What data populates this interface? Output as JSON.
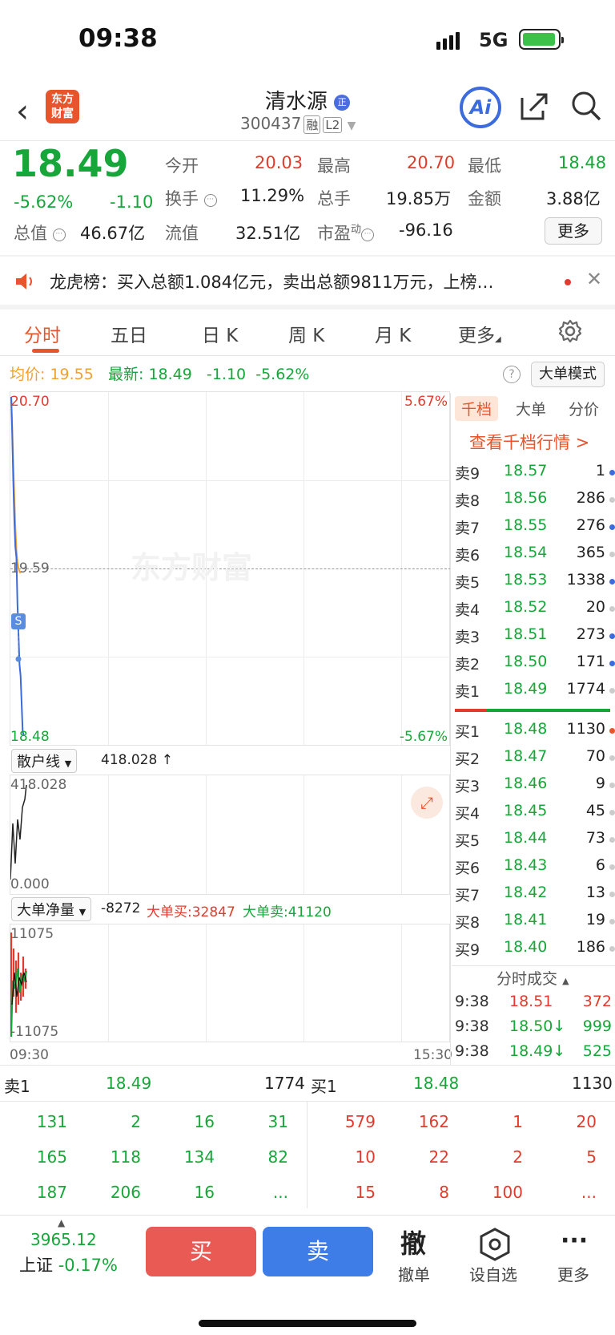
{
  "status": {
    "time": "09:38",
    "network": "5G"
  },
  "header": {
    "stock_name": "清水源",
    "badge": "正",
    "code": "300437",
    "tag_margin": "融",
    "tag_level": "L2",
    "logo_line1": "东方",
    "logo_line2": "财富",
    "ai_label": "Ai"
  },
  "quote": {
    "price": "18.49",
    "change_pct": "-5.62%",
    "change": "-1.10",
    "open_label": "今开",
    "open": "20.03",
    "high_label": "最高",
    "high": "20.70",
    "low_label": "最低",
    "low": "18.48",
    "turnover_label": "换手",
    "turnover": "11.29%",
    "volume_label": "总手",
    "volume": "19.85万",
    "amount_label": "金额",
    "amount": "3.88亿",
    "mktcap_label": "总值",
    "mktcap": "46.67亿",
    "float_label": "流值",
    "float": "32.51亿",
    "pe_label": "市盈",
    "pe_sup": "动",
    "pe": "-96.16",
    "more": "更多"
  },
  "notice": {
    "text": "龙虎榜：买入总额1.084亿元，卖出总额9811万元，上榜…"
  },
  "tabs": [
    "分时",
    "五日",
    "日 K",
    "周 K",
    "月 K",
    "更多"
  ],
  "avg": {
    "avg_label": "均价:",
    "avg": "19.55",
    "latest_label": "最新:",
    "latest": "18.49",
    "chg": "-1.10",
    "pct": "-5.62%",
    "bigmode": "大单模式",
    "help": "?"
  },
  "chart": {
    "y_high": "20.70",
    "y_mid": "19.59",
    "y_low": "18.48",
    "pct_high": "5.67%",
    "pct_low": "-5.67%",
    "s_marker": "S",
    "watermark": "东方财富",
    "sub1_select": "散户线",
    "sub1_value": "418.028 ↑",
    "sub1_top": "418.028",
    "sub1_bottom": "0.000",
    "sub2_select": "大单净量",
    "sub2_value": "-8272",
    "sub2_buy": "大单买:32847",
    "sub2_sell": "大单卖:41120",
    "sub2_top": "11075",
    "sub2_bottom": "-11075",
    "t_start": "09:30",
    "t_end": "15:30",
    "price_points": [
      20.7,
      20.45,
      20.15,
      19.9,
      19.72,
      19.65,
      19.35,
      19.15,
      18.95,
      18.88,
      18.7,
      18.52,
      18.49
    ],
    "avg_points": [
      20.7,
      20.5,
      20.25,
      20.05,
      19.85,
      19.7,
      19.62,
      19.58,
      19.56,
      19.55
    ]
  },
  "orderbook": {
    "tabs": [
      "千档",
      "大单",
      "分价"
    ],
    "link": "查看千档行情 >",
    "asks": [
      {
        "l": "卖9",
        "p": "18.57",
        "v": "1",
        "c": "#3b6bdc"
      },
      {
        "l": "卖8",
        "p": "18.56",
        "v": "286",
        "c": "#ccc"
      },
      {
        "l": "卖7",
        "p": "18.55",
        "v": "276",
        "c": "#3b6bdc"
      },
      {
        "l": "卖6",
        "p": "18.54",
        "v": "365",
        "c": "#ccc"
      },
      {
        "l": "卖5",
        "p": "18.53",
        "v": "1338",
        "c": "#3b6bdc"
      },
      {
        "l": "卖4",
        "p": "18.52",
        "v": "20",
        "c": "#ccc"
      },
      {
        "l": "卖3",
        "p": "18.51",
        "v": "273",
        "c": "#3b6bdc"
      },
      {
        "l": "卖2",
        "p": "18.50",
        "v": "171",
        "c": "#3b6bdc"
      },
      {
        "l": "卖1",
        "p": "18.49",
        "v": "1774",
        "c": "#ccc"
      }
    ],
    "bids": [
      {
        "l": "买1",
        "p": "18.48",
        "v": "1130",
        "c": "#e8542b"
      },
      {
        "l": "买2",
        "p": "18.47",
        "v": "70",
        "c": "#ccc"
      },
      {
        "l": "买3",
        "p": "18.46",
        "v": "9",
        "c": "#ccc"
      },
      {
        "l": "买4",
        "p": "18.45",
        "v": "45",
        "c": "#ccc"
      },
      {
        "l": "买5",
        "p": "18.44",
        "v": "73",
        "c": "#ccc"
      },
      {
        "l": "买6",
        "p": "18.43",
        "v": "6",
        "c": "#ccc"
      },
      {
        "l": "买7",
        "p": "18.42",
        "v": "13",
        "c": "#ccc"
      },
      {
        "l": "买8",
        "p": "18.41",
        "v": "19",
        "c": "#ccc"
      },
      {
        "l": "买9",
        "p": "18.40",
        "v": "186",
        "c": "#ccc"
      }
    ],
    "trades_title": "分时成交",
    "trades": [
      {
        "t": "9:38",
        "p": "18.51",
        "v": "372",
        "c": "red"
      },
      {
        "t": "9:38",
        "p": "18.50↓",
        "v": "999",
        "c": "green"
      },
      {
        "t": "9:38",
        "p": "18.49↓",
        "v": "525",
        "c": "green"
      }
    ]
  },
  "level1": {
    "sell_label": "卖1",
    "sell_price": "18.49",
    "sell_vol": "1774",
    "buy_label": "买1",
    "buy_price": "18.48",
    "buy_vol": "1130",
    "sell_queue": [
      [
        "131",
        "2",
        "16",
        "31"
      ],
      [
        "165",
        "118",
        "134",
        "82"
      ],
      [
        "187",
        "206",
        "16",
        "..."
      ]
    ],
    "buy_queue": [
      [
        "579",
        "162",
        "1",
        "20"
      ],
      [
        "10",
        "22",
        "2",
        "5"
      ],
      [
        "15",
        "8",
        "100",
        "..."
      ]
    ]
  },
  "nav": {
    "index_value": "3965.12",
    "index_name": "上证",
    "index_pct": "-0.17%",
    "buy": "买",
    "sell": "卖",
    "cancel_icon": "撤",
    "cancel": "撤单",
    "watch": "设自选",
    "more": "更多"
  }
}
